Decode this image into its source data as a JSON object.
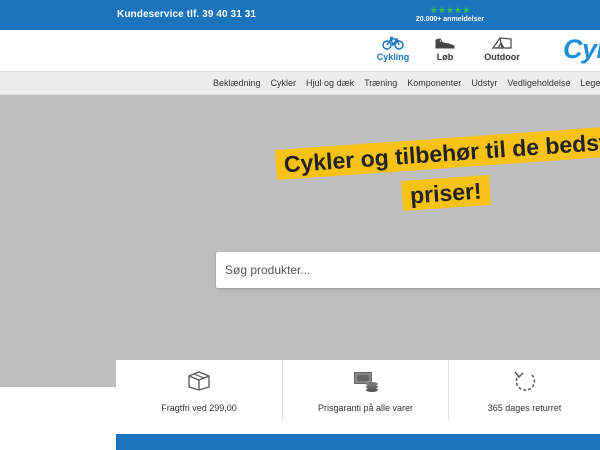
{
  "topbar": {
    "service": "Kundeservice tlf. 39 40 31 31",
    "stars": "★★★★★",
    "reviews": "20.000+ anmeldelser"
  },
  "header": {
    "categories": [
      {
        "label": "Cykling",
        "icon": "bicycle-icon",
        "active": true
      },
      {
        "label": "Løb",
        "icon": "running-shoe-icon",
        "active": false
      },
      {
        "label": "Outdoor",
        "icon": "tent-icon",
        "active": false
      }
    ],
    "logo": "Cyk"
  },
  "nav": {
    "items": [
      "Beklædning",
      "Cykler",
      "Hjul og dæk",
      "Træning",
      "Komponenter",
      "Udstyr",
      "Vedligeholdelse",
      "Lege"
    ]
  },
  "hero": {
    "headline_line1": "Cykler og tilbehør til de bedst",
    "headline_line2": "priser!",
    "search_placeholder": "Søg produkter..."
  },
  "features": [
    {
      "label": "Fragtfri ved 299,00",
      "icon": "box-icon"
    },
    {
      "label": "Prisgaranti på alle varer",
      "icon": "money-icon"
    },
    {
      "label": "365 dages returret",
      "icon": "return-arrow-icon"
    }
  ],
  "colors": {
    "brand_blue": "#1b74bb",
    "accent_yellow": "#f6c215",
    "star_green": "#35c05a"
  }
}
